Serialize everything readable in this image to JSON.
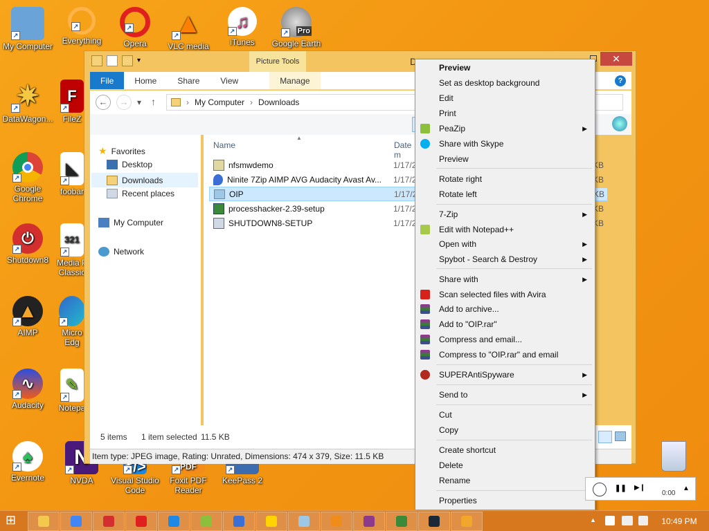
{
  "desktop": {
    "icons": [
      {
        "label": "My Computer"
      },
      {
        "label": "Everything"
      },
      {
        "label": "Opera"
      },
      {
        "label": "VLC media"
      },
      {
        "label": "iTunes"
      },
      {
        "label": "Google Earth",
        "badge": "Pro"
      },
      {
        "label": "DataWagon..."
      },
      {
        "label": "FileZ"
      },
      {
        "label": "Google Chrome"
      },
      {
        "label": "foobar"
      },
      {
        "label": "Shutdown8"
      },
      {
        "label": "Media P Classic",
        "badge": "321"
      },
      {
        "label": "AIMP"
      },
      {
        "label": "Micro Edg"
      },
      {
        "label": "Audacity"
      },
      {
        "label": "Notepa"
      },
      {
        "label": "Evernote"
      },
      {
        "label": "NVDA"
      },
      {
        "label": "Visual Studio Code"
      },
      {
        "label": "Foxit PDF Reader",
        "badge": "PDF"
      },
      {
        "label": "KeePass 2"
      }
    ]
  },
  "window": {
    "title_fragment": "D",
    "contextual_tab_group": "Picture Tools",
    "close_glyph": "✕",
    "ribbon_tabs": [
      "File",
      "Home",
      "Share",
      "View",
      "Manage"
    ],
    "help_glyph": "?",
    "address": {
      "root": "My Computer",
      "separator": "›",
      "folder": "Downloads"
    },
    "nav_glyphs": {
      "back": "←",
      "forward": "→",
      "dropdown": "▾",
      "up": "↑"
    },
    "nav_pane": {
      "favorites_header": "Favorites",
      "favorites": [
        "Desktop",
        "Downloads",
        "Recent places"
      ],
      "computer": "My Computer",
      "network": "Network"
    },
    "columns": {
      "name": "Name",
      "date": "Date m"
    },
    "files": [
      {
        "name": "nfsmwdemo",
        "date": "1/17/2",
        "size": "KB"
      },
      {
        "name": "Ninite 7Zip AIMP AVG Audacity Avast Av...",
        "date": "1/17/2",
        "size": "KB"
      },
      {
        "name": "OIP",
        "date": "1/17/2",
        "size": "KB",
        "selected": true
      },
      {
        "name": "processhacker-2.39-setup",
        "date": "1/17/2",
        "size": "KB"
      },
      {
        "name": "SHUTDOWN8-SETUP",
        "date": "1/17/2",
        "size": "KB"
      }
    ],
    "status": {
      "count": "5 items",
      "selection": "1 item selected",
      "size": "11.5 KB"
    },
    "info": "Item type: JPEG image, Rating: Unrated, Dimensions: 474 x 379, Size: 11.5 KB"
  },
  "context_menu": {
    "items": [
      {
        "label": "Preview",
        "bold": true
      },
      {
        "label": "Set as desktop background"
      },
      {
        "label": "Edit"
      },
      {
        "label": "Print"
      },
      {
        "label": "PeaZip",
        "submenu": true,
        "icon": "peazip-icon",
        "color": "#8bbf3c"
      },
      {
        "label": "Share with Skype",
        "icon": "skype-icon",
        "color": "#00aff0"
      },
      {
        "label": "Preview"
      },
      {
        "label": "Rotate right"
      },
      {
        "label": "Rotate left"
      },
      {
        "label": "7-Zip",
        "submenu": true
      },
      {
        "label": "Edit with Notepad++",
        "icon": "notepadpp-icon",
        "color": "#a7c94b"
      },
      {
        "label": "Open with",
        "submenu": true
      },
      {
        "label": "Spybot - Search & Destroy",
        "submenu": true
      },
      {
        "label": "Share with",
        "submenu": true
      },
      {
        "label": "Scan selected files with Avira",
        "icon": "avira-icon",
        "color": "#d6221b"
      },
      {
        "label": "Add to archive...",
        "icon": "winrar-icon",
        "color": "#8c3b8c"
      },
      {
        "label": "Add to \"OIP.rar\"",
        "icon": "winrar-icon",
        "color": "#8c3b8c"
      },
      {
        "label": "Compress and email...",
        "icon": "winrar-icon",
        "color": "#8c3b8c"
      },
      {
        "label": "Compress to \"OIP.rar\" and email",
        "icon": "winrar-icon",
        "color": "#8c3b8c"
      },
      {
        "label": "SUPERAntiSpyware",
        "submenu": true,
        "icon": "superantispyware-icon",
        "color": "#b02a1e"
      },
      {
        "label": "Send to",
        "submenu": true
      },
      {
        "label": "Cut"
      },
      {
        "label": "Copy"
      },
      {
        "label": "Create shortcut"
      },
      {
        "label": "Delete"
      },
      {
        "label": "Rename"
      },
      {
        "label": "Properties"
      }
    ],
    "submenu_glyph": "▶"
  },
  "player": {
    "time": "0:00"
  },
  "taskbar": {
    "start_glyph": "⊞",
    "apps": [
      {
        "name": "file-explorer-icon",
        "color": "#f2c94c"
      },
      {
        "name": "chrome-icon",
        "color": "#4285f4"
      },
      {
        "name": "shutdown8-icon",
        "color": "#d32f2f"
      },
      {
        "name": "opera-icon",
        "color": "#e0201f"
      },
      {
        "name": "edge-icon",
        "color": "#1e88e5"
      },
      {
        "name": "peazip-icon",
        "color": "#8bbf3c"
      },
      {
        "name": "ninite-icon",
        "color": "#3b6fd6"
      },
      {
        "name": "foxit-icon",
        "color": "#ffd400"
      },
      {
        "name": "photos-icon",
        "color": "#9ec7e6"
      },
      {
        "name": "everything-icon",
        "color": "#f08c1a"
      },
      {
        "name": "winrar-icon",
        "color": "#8c3b8c"
      },
      {
        "name": "processhacker-icon",
        "color": "#3a8a3a"
      },
      {
        "name": "steam-icon",
        "color": "#1b2838"
      },
      {
        "name": "aimp-icon",
        "color": "#f2a72c"
      }
    ],
    "tray_glyph": "▲",
    "clock": "10:49 PM"
  }
}
